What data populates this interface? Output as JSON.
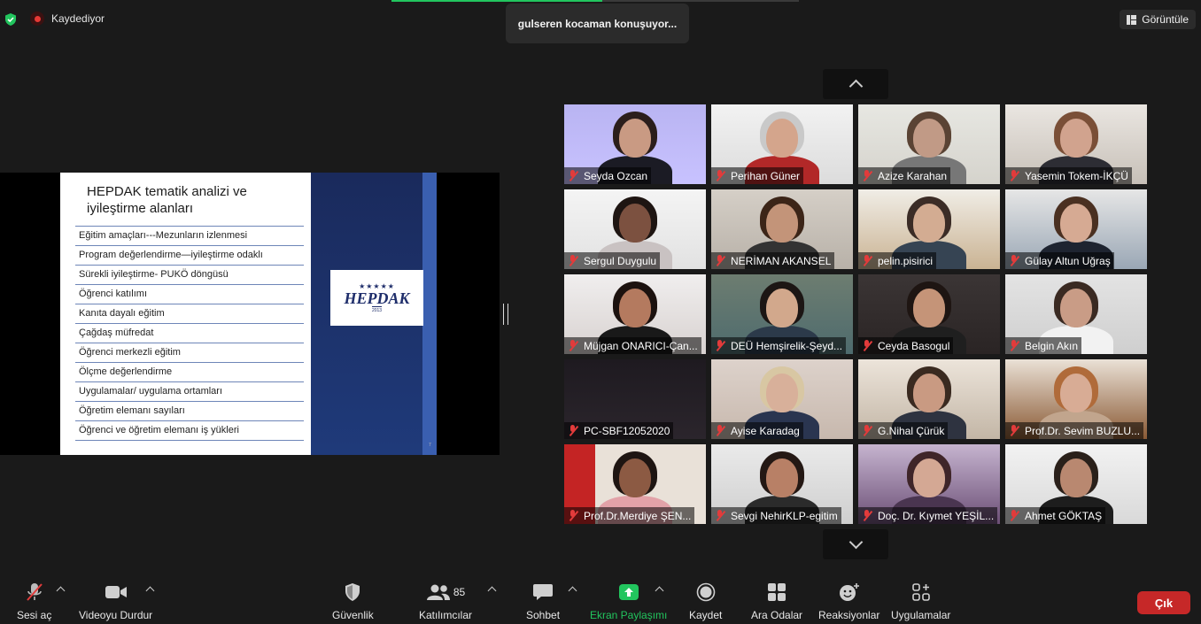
{
  "top": {
    "recording_label": "Kaydediyor",
    "active_speaker": "gulseren kocaman konuşuyor...",
    "view_button": "Görüntüle"
  },
  "slide": {
    "title": "HEPDAK tematik analizi ve iyileştirme alanları",
    "items": [
      "Eğitim amaçları---Mezunların izlenmesi",
      "Program değerlendirme—iyileştirme odaklı",
      "Sürekli iyileştirme- PUKÖ döngüsü",
      "Öğrenci katılımı",
      "Kanıta dayalı eğitim",
      "Çağdaş müfredat",
      "Öğrenci merkezli eğitim",
      "Ölçme değerlendirme",
      "Uygulamalar/ uygulama ortamları",
      "Öğretim elemanı sayıları",
      "Öğrenci ve öğretim elemanı iş yükleri"
    ],
    "logo_stars": "★★★★★",
    "logo_text": "HEPDAK",
    "logo_year": "2013",
    "page_number": "7"
  },
  "participants": [
    {
      "name": "Seyda Ozcan"
    },
    {
      "name": "Perihan Güner"
    },
    {
      "name": "Azize Karahan"
    },
    {
      "name": "Yasemin Tokem-İKÇÜ"
    },
    {
      "name": "Sergul Duygulu"
    },
    {
      "name": "NERİMAN AKANSEL"
    },
    {
      "name": "pelin.pisirici"
    },
    {
      "name": "Gülay Altun Uğraş"
    },
    {
      "name": "Müjgan ONARICI-Çan..."
    },
    {
      "name": "DEÜ Hemşirelik-Şeyd..."
    },
    {
      "name": "Ceyda Basogul"
    },
    {
      "name": "Belgin Akın"
    },
    {
      "name": "PC-SBF12052020"
    },
    {
      "name": "Ayise Karadag"
    },
    {
      "name": "G.Nihal Çürük"
    },
    {
      "name": "Prof.Dr. Sevim BUZLU..."
    },
    {
      "name": "Prof.Dr.Merdiye ŞEN..."
    },
    {
      "name": "Sevgi NehirKLP-egitim"
    },
    {
      "name": "Doç. Dr. Kıymet YEŞİL..."
    },
    {
      "name": "Ahmet GÖKTAŞ"
    }
  ],
  "toolbar": {
    "unmute": "Sesi aç",
    "stop_video": "Videoyu Durdur",
    "security": "Güvenlik",
    "participants": "Katılımcılar",
    "participants_count": "85",
    "chat": "Sohbet",
    "share_screen": "Ekran Paylaşımı",
    "record": "Kaydet",
    "breakout": "Ara Odalar",
    "reactions": "Reaksiyonlar",
    "apps": "Uygulamalar",
    "leave": "Çık"
  },
  "colors": {
    "leave_red": "#c62828",
    "share_green": "#22c55e",
    "mute_red": "#e23b3b"
  }
}
